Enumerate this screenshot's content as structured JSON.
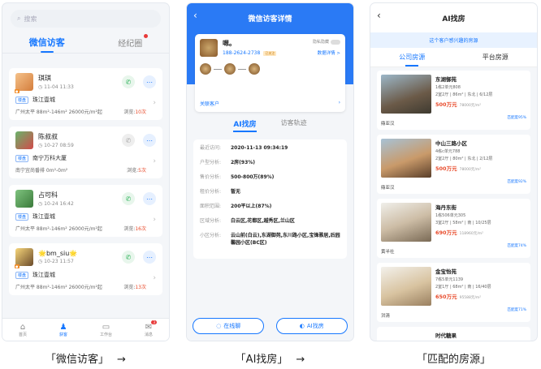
{
  "phone1": {
    "search_placeholder": "搜索",
    "tab_active": "微信访客",
    "tab_other": "经纪圈",
    "visitors": [
      {
        "name": "琪琪",
        "time": "11-04 11:33",
        "tag": "楼盘",
        "property": "珠江壹城",
        "stats": "广州太平  88m²-146m²  26000元/m²起",
        "views_label": "浏览:",
        "views": "10次"
      },
      {
        "name": "陈叔叔",
        "time": "10-27 08:59",
        "tag": "楼盘",
        "property": "南宁万科大厦",
        "stats": "南宁宜尚番排  0m²-0m²",
        "views_label": "浏览:",
        "views": "5次"
      },
      {
        "name": "占可科",
        "time": "10-24 16:42",
        "tag": "楼盘",
        "property": "珠江壹城",
        "stats": "广州太平  88m²-146m²  26000元/m²起",
        "views_label": "浏览:",
        "views": "16次"
      },
      {
        "name": "🌟bm_siu🌟",
        "time": "10-23 11:57",
        "tag": "楼盘",
        "property": "珠江壹城",
        "stats": "广州太平  88m²-146m²  26000元/m²起",
        "views_label": "浏览:",
        "views": "13次"
      }
    ],
    "nav": [
      {
        "label": "首页",
        "icon": "⌂"
      },
      {
        "label": "获客",
        "icon": "♟"
      },
      {
        "label": "工作台",
        "icon": "▭"
      },
      {
        "label": "消息",
        "icon": "✉",
        "badge": "3"
      }
    ]
  },
  "phone2": {
    "title": "微信访客详情",
    "name": "嗯。",
    "phone": "188-2624-2738",
    "badge": "已关注",
    "hide_label": "隐私隐藏",
    "data_link": "数据详情 >",
    "related": "关联客户",
    "tab_active": "AI找房",
    "tab_other": "访客轨迹",
    "fields": [
      {
        "k": "最近访问:",
        "v": "2020-11-13 09:34:19"
      },
      {
        "k": "户型分析:",
        "v": "2房(93%)"
      },
      {
        "k": "售价分析:",
        "v": "500-800万(89%)"
      },
      {
        "k": "租价分析:",
        "v": "暂无"
      },
      {
        "k": "面积范围:",
        "v": "200平以上(87%)"
      },
      {
        "k": "区域分析:",
        "v": "白云区,花都区,越秀区,兰山区"
      },
      {
        "k": "小区分析:",
        "v": "云山前(白云),东湖御苑,东川路小区,宝锋雅居,后园馨园小区(BC区)"
      }
    ],
    "btn_chat": "在线聊",
    "btn_ai": "AI找房"
  },
  "phone3": {
    "title": "AI找房",
    "hint": "这个客户感兴趣的房源",
    "tab_active": "公司房源",
    "tab_other": "平台房源",
    "houses": [
      {
        "name": "东湖御苑",
        "sub1": "1栋2单元808",
        "sub2": "2室2厅 | 86m² | 东北 | 6/12层",
        "price": "500万元",
        "unit": "78000元/m²",
        "district": "鼎亚汉",
        "match": "匹配度95%"
      },
      {
        "name": "中山三路小区",
        "sub1": "4栋c单元788",
        "sub2": "2室2厅 | 80m² | 东北 | 2/12层",
        "price": "500万元",
        "unit": "78000元/m²",
        "district": "鼎亚汉",
        "match": "匹配度92%"
      },
      {
        "name": "海丹东街",
        "sub1": "1栋506单元305",
        "sub2": "3室2厅 | 58m² | 南 | 10/25层",
        "price": "690万元",
        "unit": "118960元/m²",
        "district": "黄半社",
        "match": "匹配度74%"
      },
      {
        "name": "金宝怡苑",
        "sub1": "7栋5单元1139",
        "sub2": "2室1厅 | 68m² | 南 | 16/40层",
        "price": "650万元",
        "unit": "95588元/m²",
        "district": "洪清",
        "match": "匹配度71%"
      }
    ],
    "last_partial": "时代糖果"
  },
  "captions": [
    "「微信访客」",
    "「AI找房」",
    "「匹配的房源」"
  ],
  "arrow": "→",
  "colors": {
    "accent": "#1677ff",
    "header_blue": "#2a7af5",
    "price_red": "#e84a2a"
  }
}
